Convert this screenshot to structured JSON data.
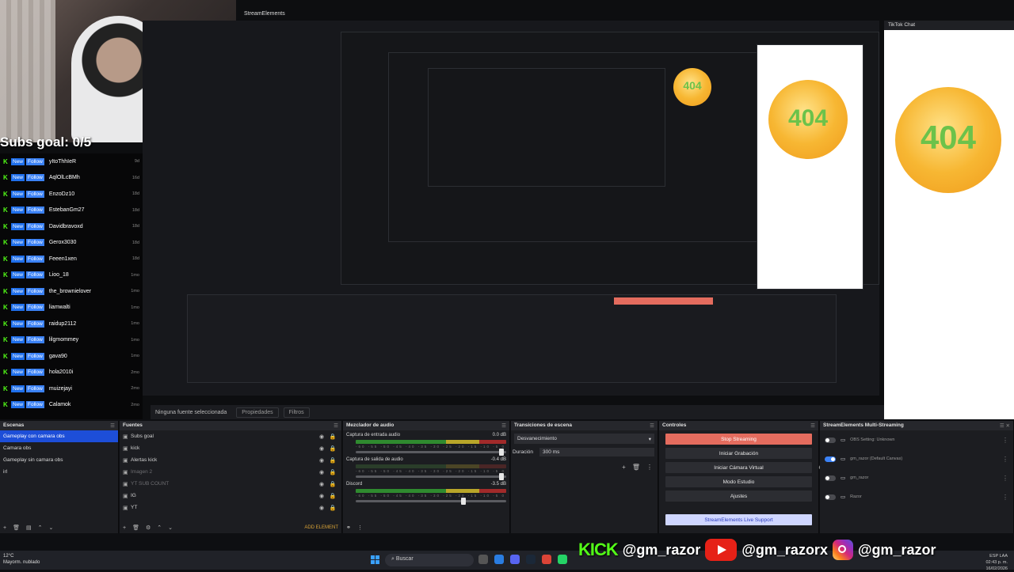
{
  "window": {
    "title": "StreamElements",
    "tiktok_title": "TikTok Chat"
  },
  "overlay": {
    "subs_goal": "Subs goal: 0/5",
    "badge_text": "404"
  },
  "followers": [
    {
      "name": "yItoThhIeR",
      "time": "9d"
    },
    {
      "name": "AqlOlLcBMh",
      "time": "16d"
    },
    {
      "name": "EnzoDz10",
      "time": "18d"
    },
    {
      "name": "EstebanGm27",
      "time": "18d"
    },
    {
      "name": "Davidbravoxd",
      "time": "18d"
    },
    {
      "name": "Gerox3030",
      "time": "18d"
    },
    {
      "name": "Feeen1xen",
      "time": "18d"
    },
    {
      "name": "Lioo_18",
      "time": "1mo"
    },
    {
      "name": "the_brownielover",
      "time": "1mo"
    },
    {
      "name": "liamwalti",
      "time": "1mo"
    },
    {
      "name": "raidup2112",
      "time": "1mo"
    },
    {
      "name": "lilgmommey",
      "time": "1mo"
    },
    {
      "name": "gava90",
      "time": "1mo"
    },
    {
      "name": "hola2010i",
      "time": "2mo"
    },
    {
      "name": "muizejayi",
      "time": "2mo"
    },
    {
      "name": "Calamok",
      "time": "2mo"
    }
  ],
  "follower_labels": {
    "new": "New",
    "follow": "Follow"
  },
  "status": {
    "no_source": "Ninguna fuente seleccionada",
    "properties": "Propiedades",
    "filters": "Filtros"
  },
  "scenes": {
    "title": "Escenas",
    "items": [
      "Gameplay con camara obs",
      "Camara obs",
      "Gameplay sin camara obs",
      "irl"
    ],
    "selected": 0
  },
  "sources": {
    "title": "Fuentes",
    "items": [
      {
        "name": "Subs goal",
        "dim": false
      },
      {
        "name": "kick",
        "dim": false
      },
      {
        "name": "Alertas kick",
        "dim": false
      },
      {
        "name": "Imagen 2",
        "dim": true
      },
      {
        "name": "YT SUB COUNT",
        "dim": true
      },
      {
        "name": "IG",
        "dim": false
      },
      {
        "name": "YT",
        "dim": false
      }
    ],
    "add_element": "ADD ELEMENT"
  },
  "mixer": {
    "title": "Mezclador de audio",
    "channels": [
      {
        "name": "Captura de entrada audio",
        "db": "0.0 dB",
        "active": true
      },
      {
        "name": "Captura de salida de audio",
        "db": "-0.4 dB",
        "active": false
      },
      {
        "name": "Discord",
        "db": "-3.5 dB",
        "active": true
      }
    ],
    "ticks": "-60 -55 -50 -45 -40 -35 -30 -25 -20 -15 -10 -5 0"
  },
  "transitions": {
    "title": "Transiciones de escena",
    "current": "Desvanecimiento",
    "duration_label": "Duración",
    "duration_value": "300 ms"
  },
  "controls": {
    "title": "Controles",
    "buttons": [
      "Stop Streaming",
      "Iniciar Grabación",
      "Iniciar Cámara Virtual",
      "Modo Estudio",
      "Ajustes"
    ],
    "live_support": "StreamElements Live Support"
  },
  "multistream": {
    "title": "StreamElements Multi-Streaming",
    "rows": [
      {
        "line1": "OBS Setting: Unknown",
        "line2": "",
        "on": false
      },
      {
        "line1": "gm_razor (Default Canvas)",
        "line2": "",
        "on": true
      },
      {
        "line1": "gm_razor",
        "line2": "",
        "on": false
      },
      {
        "line1": "Razor",
        "line2": "",
        "on": false
      }
    ]
  },
  "taskbar": {
    "temp": "12°C",
    "weather": "Mayorm. nublado",
    "search": "Buscar",
    "tray_line1": "ESP  LAA",
    "tray_time": "02:43 p. m.",
    "tray_date": "16/02/2026"
  },
  "social": {
    "kick_label": "KICK",
    "kick_handle": "@gm_razor",
    "yt_handle": "@gm_razorx",
    "ig_handle": "@gm_razor"
  },
  "colors": {
    "accent": "#1d4ed8",
    "stop": "#e46c5e",
    "kick": "#53fc18",
    "youtube": "#e62117"
  }
}
